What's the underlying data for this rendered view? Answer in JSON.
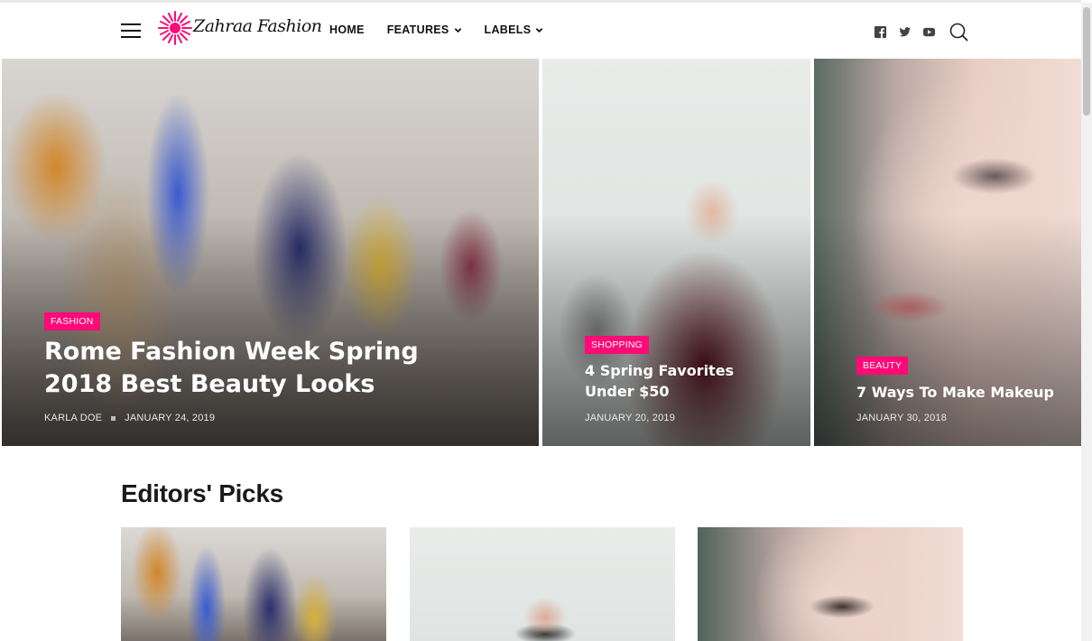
{
  "brand": {
    "logo_text": "Zahraa Fashion",
    "accent": "#ff0a76"
  },
  "header": {
    "nav": [
      {
        "label": "HOME",
        "dropdown": false
      },
      {
        "label": "FEATURES",
        "dropdown": true
      },
      {
        "label": "LABELS",
        "dropdown": true
      }
    ],
    "social_icons": [
      "facebook-icon",
      "twitter-icon",
      "youtube-icon"
    ],
    "search_icon": "search-icon"
  },
  "hero": [
    {
      "tag": "FASHION",
      "title": "Rome Fashion Week Spring 2018 Best Beauty Looks",
      "author": "KARLA DOE",
      "date": "JANUARY 24, 2019"
    },
    {
      "tag": "SHOPPING",
      "title": "4 Spring Favorites Under $50",
      "date": "JANUARY 20, 2019"
    },
    {
      "tag": "BEAUTY",
      "title": "7 Ways To Make Makeup",
      "date": "JANUARY 30, 2018"
    }
  ],
  "editors_picks": {
    "title": "Editors' Picks"
  }
}
